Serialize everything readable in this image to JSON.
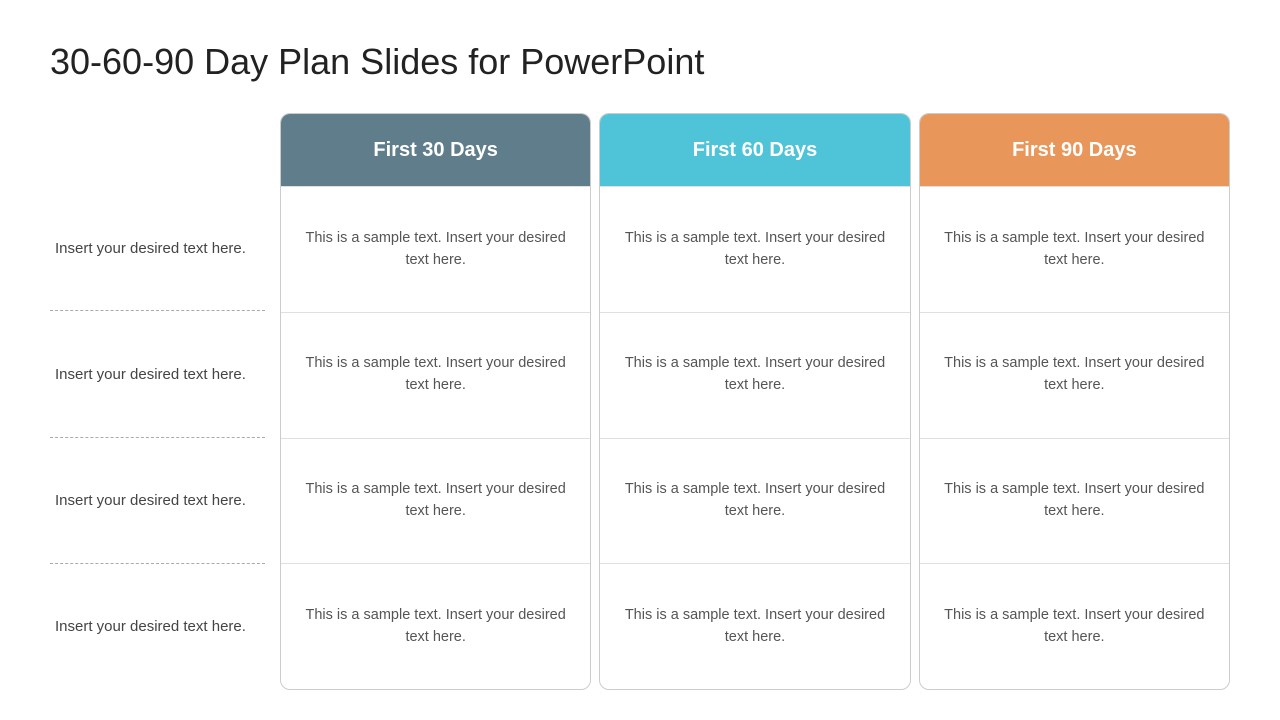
{
  "page": {
    "title": "30-60-90 Day Plan Slides for PowerPoint"
  },
  "label_column": {
    "cells": [
      "Insert your desired text here.",
      "Insert your desired text here.",
      "Insert your desired text here.",
      "Insert your desired text here."
    ]
  },
  "columns": [
    {
      "id": "col-30",
      "header": "First 30 Days",
      "color_class": "col-30",
      "cells": [
        "This is a sample text. Insert your desired text here.",
        "This is a sample text. Insert your desired text here.",
        "This is a sample text. Insert your desired text here.",
        "This is a sample text. Insert your desired text here."
      ]
    },
    {
      "id": "col-60",
      "header": "First 60 Days",
      "color_class": "col-60",
      "cells": [
        "This is a sample text. Insert your desired text here.",
        "This is a sample text. Insert your desired text here.",
        "This is a sample text. Insert your desired text here.",
        "This is a sample text. Insert your desired text here."
      ]
    },
    {
      "id": "col-90",
      "header": "First 90 Days",
      "color_class": "col-90",
      "cells": [
        "This is a sample text. Insert your desired text here.",
        "This is a sample text. Insert your desired text here.",
        "This is a sample text. Insert your desired text here.",
        "This is a sample text. Insert your desired text here."
      ]
    }
  ]
}
